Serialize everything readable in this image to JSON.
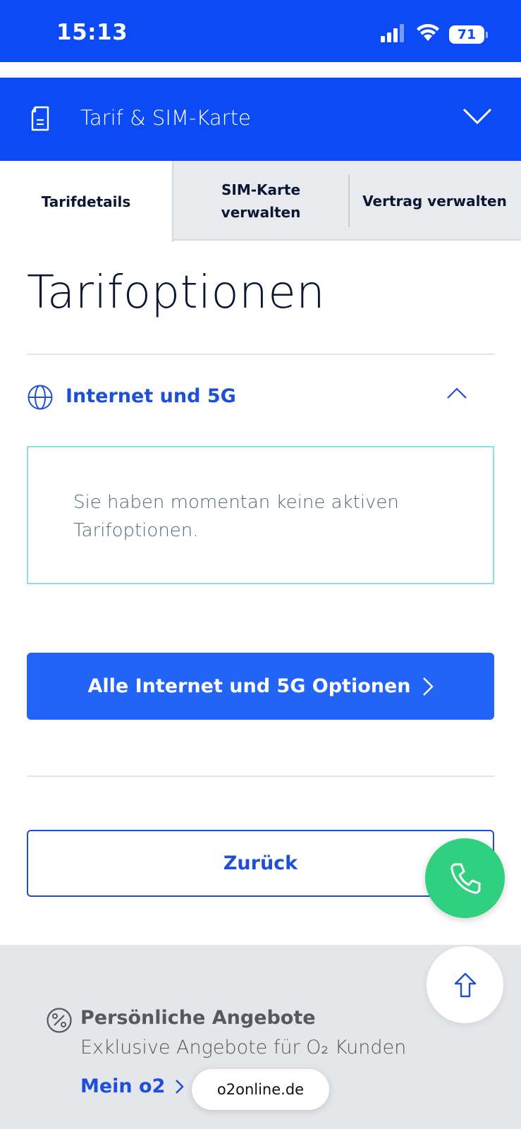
{
  "status_bar": {
    "time": "15:13",
    "battery": "71"
  },
  "tariff_bar": {
    "title": "Tarif & SIM-Karte"
  },
  "tabs": [
    {
      "label": "Tarifdetails"
    },
    {
      "label": "SIM-Karte verwalten"
    },
    {
      "label": "Vertrag verwalten"
    }
  ],
  "main": {
    "heading": "Tarifoptionen",
    "accordion_label": "Internet und 5G",
    "info_text": "Sie haben momentan keine aktiven Tarifoptionen.",
    "primary_button": "Alle Internet und 5G Optionen",
    "back_button": "Zurück"
  },
  "footer": {
    "title": "Persönliche Angebote",
    "subtitle": "Exklusive Angebote für O₂ Kunden",
    "link": "Mein o2"
  },
  "browser": {
    "url": "o2online.de"
  },
  "colors": {
    "brand_blue": "#0b4af5",
    "button_blue": "#2264f6",
    "link_blue": "#1d4fd8",
    "call_green": "#2fd07f"
  },
  "icons": [
    "signal-icon",
    "wifi-icon",
    "battery-icon",
    "document-icon",
    "chevron-down-icon",
    "globe-icon",
    "chevron-up-icon",
    "chevron-right-icon",
    "phone-icon",
    "arrow-up-icon",
    "percent-icon"
  ]
}
